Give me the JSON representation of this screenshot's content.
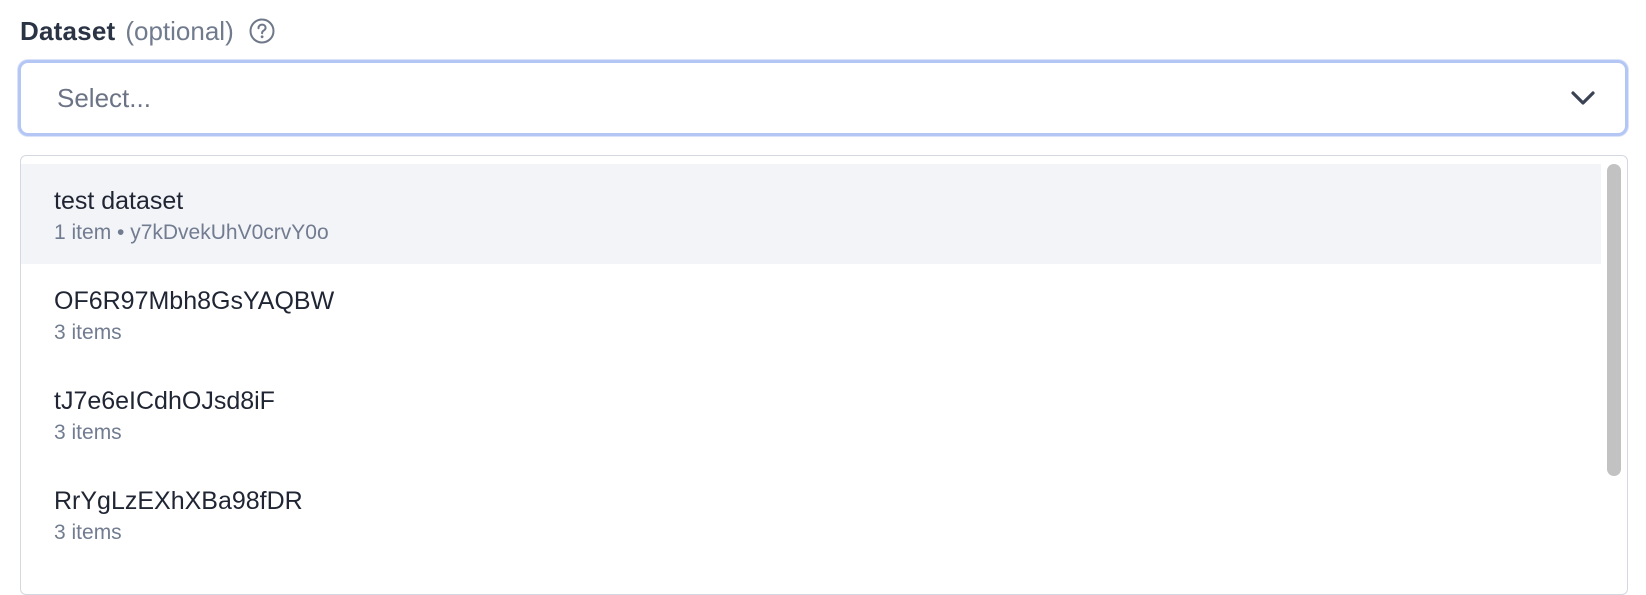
{
  "field": {
    "label": "Dataset",
    "optional_text": "(optional)",
    "help_icon": "question-circle-icon"
  },
  "select": {
    "placeholder": "Select...",
    "chevron_icon": "chevron-down-icon"
  },
  "options": [
    {
      "title": "test dataset",
      "subtitle": "1 item • y7kDvekUhV0crvY0o",
      "highlighted": true
    },
    {
      "title": "OF6R97Mbh8GsYAQBW",
      "subtitle": "3 items",
      "highlighted": false
    },
    {
      "title": "tJ7e6eICdhOJsd8iF",
      "subtitle": "3 items",
      "highlighted": false
    },
    {
      "title": "RrYgLzEXhXBa98fDR",
      "subtitle": "3 items",
      "highlighted": false
    }
  ],
  "colors": {
    "focus_border": "#b4c6f3",
    "highlight_bg": "#f3f4f8",
    "scrollbar": "#c2c2c2"
  }
}
